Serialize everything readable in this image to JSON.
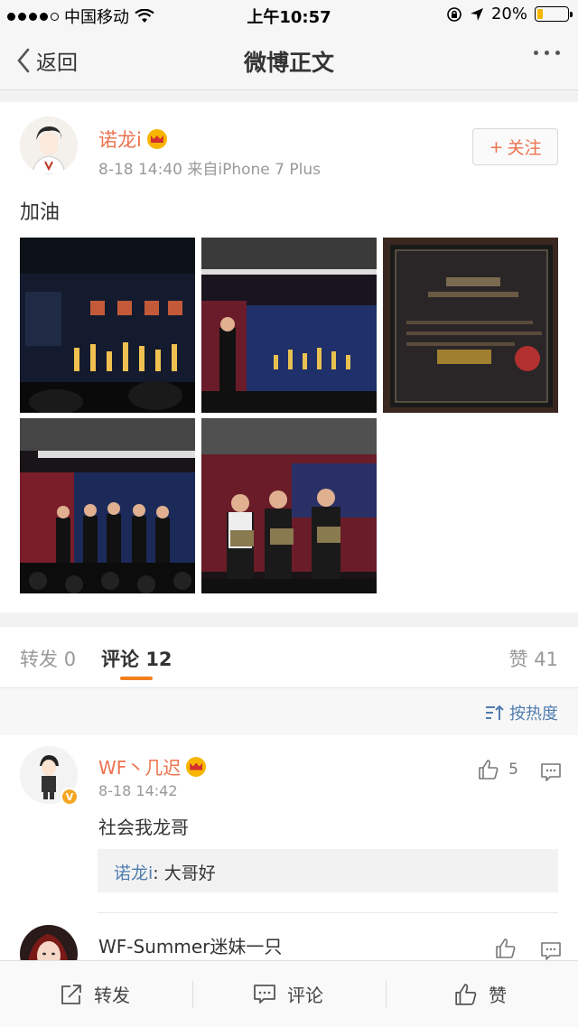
{
  "status_bar": {
    "carrier": "中国移动",
    "time": "上午10:57",
    "battery": "20%",
    "battery_level": 0.2
  },
  "nav": {
    "back_label": "返回",
    "title": "微博正文"
  },
  "post": {
    "author": "诺龙i",
    "meta": "8-18 14:40  来自iPhone 7 Plus",
    "follow_label": "关注",
    "text": "加油",
    "photo_count": 5
  },
  "tabs": [
    {
      "label": "转发",
      "count": "0"
    },
    {
      "label": "评论",
      "count": "12"
    },
    {
      "label": "赞",
      "count": "41"
    }
  ],
  "sort_label": "按热度",
  "comments": [
    {
      "author": "WF丶几迟",
      "time": "8-18 14:42",
      "text": "社会我龙哥",
      "likes": "5",
      "reply": {
        "author": "诺龙i",
        "text": "大哥好"
      }
    },
    {
      "author": "WF-Summer迷妹一只",
      "time": "",
      "text": "",
      "likes": ""
    }
  ],
  "bottom_bar": {
    "repost_label": "转发",
    "comment_label": "评论",
    "like_label": "赞"
  },
  "colors": {
    "orange_name": "#eb7350",
    "link_blue": "#507daf",
    "tab_underline": "#f08020"
  }
}
